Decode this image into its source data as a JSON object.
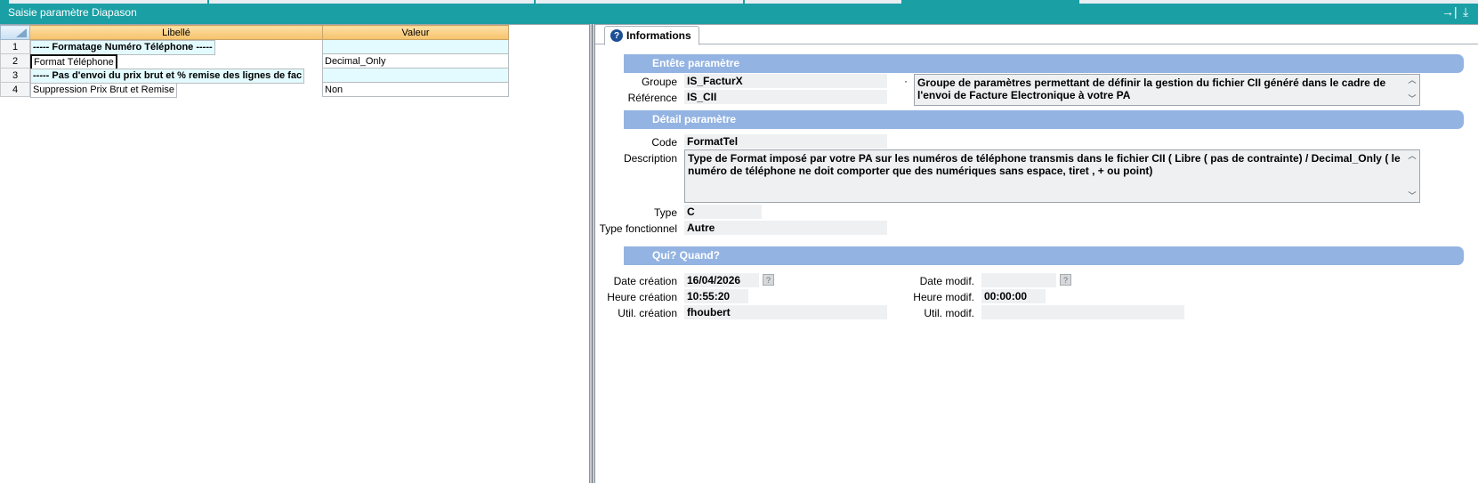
{
  "window": {
    "title": "Saisie paramètre Diapason",
    "pin_icon": "pin-right-icon",
    "download_icon": "download-icon"
  },
  "grid": {
    "headers": [
      "Libellé",
      "Valeur"
    ],
    "rows": [
      {
        "num": "1",
        "label": "----- Formatage Numéro Téléphone -----",
        "value": "",
        "section": true
      },
      {
        "num": "2",
        "label": "Format Téléphone",
        "value": "Decimal_Only",
        "section": false
      },
      {
        "num": "3",
        "label": "----- Pas d'envoi du prix brut et % remise des lignes de fac",
        "value": "",
        "section": true
      },
      {
        "num": "4",
        "label": "Suppression Prix Brut et Remise",
        "value": "Non",
        "section": false
      }
    ]
  },
  "tab": {
    "label": "Informations"
  },
  "entete": {
    "title": "Entête paramètre",
    "groupe_label": "Groupe",
    "groupe_value": "IS_FacturX",
    "reference_label": "Référence",
    "reference_value": "IS_CII",
    "dot": "·",
    "groupe_description": "Groupe de paramètres permettant de définir la gestion du fichier CII généré dans le cadre de l'envoi de Facture Electronique à votre PA"
  },
  "detail": {
    "title": "Détail paramètre",
    "code_label": "Code",
    "code_value": "FormatTel",
    "description_label": "Description",
    "description_value": "Type de Format imposé par votre PA sur les numéros de téléphone transmis dans le fichier CII ( Libre ( pas de contrainte) / Decimal_Only ( le numéro de téléphone ne doit comporter que des numériques sans espace, tiret , + ou point)",
    "type_label": "Type",
    "type_value": "C",
    "type_fonctionnel_label": "Type fonctionnel",
    "type_fonctionnel_value": "Autre"
  },
  "qui": {
    "title": "Qui? Quand?",
    "date_creation_label": "Date création",
    "date_creation_value": "16/04/2026",
    "heure_creation_label": "Heure création",
    "heure_creation_value": "10:55:20",
    "util_creation_label": "Util. création",
    "util_creation_value": "fhoubert",
    "date_modif_label": "Date modif.",
    "date_modif_value": "",
    "heure_modif_label": "Heure modif.",
    "heure_modif_value": "00:00:00",
    "util_modif_label": "Util. modif.",
    "util_modif_value": "",
    "calendar_button": "?"
  }
}
